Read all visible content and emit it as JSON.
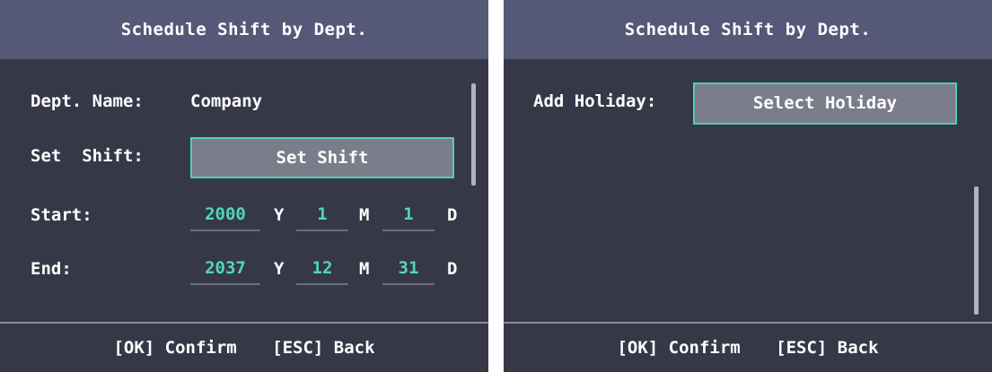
{
  "left_panel": {
    "title": "Schedule Shift by Dept.",
    "dept_name_label": "Dept. Name:",
    "dept_name_value": "Company",
    "set_shift_label": "Set  Shift:",
    "set_shift_button": "Set Shift",
    "start_label": "Start:",
    "start": {
      "year": "2000",
      "month": "1",
      "day": "1"
    },
    "end_label": "End:",
    "end": {
      "year": "2037",
      "month": "12",
      "day": "31"
    },
    "units": {
      "year": "Y",
      "month": "M",
      "day": "D"
    },
    "footer": {
      "confirm": "[OK] Confirm",
      "back": "[ESC] Back"
    }
  },
  "right_panel": {
    "title": "Schedule Shift by Dept.",
    "add_holiday_label": "Add Holiday:",
    "select_holiday_button": "Select Holiday",
    "footer": {
      "confirm": "[OK] Confirm",
      "back": "[ESC] Back"
    }
  },
  "colors": {
    "background": "#363848",
    "titlebar": "#555876",
    "accent": "#4fd7b9",
    "button_fill": "#7b7d8b"
  }
}
